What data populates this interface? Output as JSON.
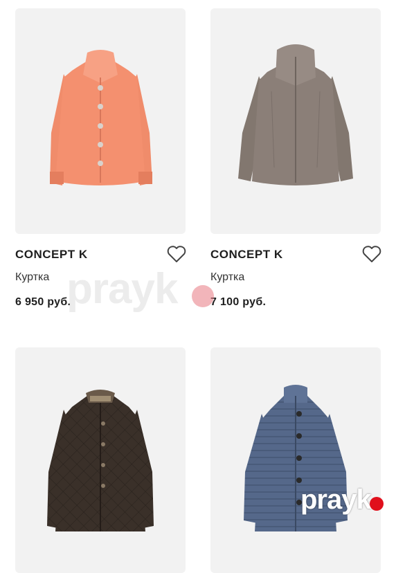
{
  "products": [
    {
      "brand": "CONCEPT K",
      "type": "Куртка",
      "price": "6 950 руб.",
      "image": "coral-jacket",
      "color": "#f4906f"
    },
    {
      "brand": "CONCEPT K",
      "type": "Куртка",
      "price": "7 100 руб.",
      "image": "taupe-hooded-jacket",
      "color": "#8b7f78"
    },
    {
      "brand": "",
      "type": "",
      "price": "",
      "image": "dark-brown-quilted-jacket",
      "color": "#3a3029"
    },
    {
      "brand": "",
      "type": "",
      "price": "",
      "image": "blue-quilted-jacket",
      "color": "#55688a"
    }
  ],
  "watermark": {
    "text": "prayk",
    "dot_color": "#e0101c"
  }
}
